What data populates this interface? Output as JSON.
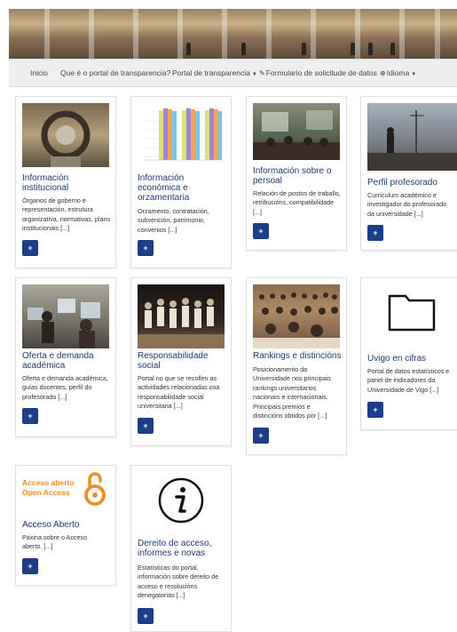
{
  "nav": {
    "home": "Inicio",
    "about": "Que é o portal de transparencia?",
    "portal": "Portal de transparencia",
    "form": "Formulario de solicitude de datos",
    "language": "Idioma"
  },
  "cards": [
    {
      "title": "Información institucional",
      "desc": "Órganos de goberno e representación, estrutura organizativa, normativas, plans institucionais [...]",
      "button": "+"
    },
    {
      "title": "Información económica e orzamentaria",
      "desc": "Orzamento, contratación, subvención, patrimonio, convenios [...]",
      "button": "+"
    },
    {
      "title": "Información sobre o persoal",
      "desc": "Relación de postos de traballo, retribucións, compatibilidade [...]",
      "button": "+"
    },
    {
      "title": "Perfil profesorado",
      "desc": "Currículum académico e investigador do profesorado da universidade [...]",
      "button": "+"
    },
    {
      "title": "Oferta e demanda académica",
      "desc": "Oferta e demanda académica, guías docentes, perfil do profesorado [...]",
      "button": "+"
    },
    {
      "title": "Responsabilidade social",
      "desc": "Portal no que se recollen as actividades relacionadas coa responsabilidade social universitaria [...]",
      "button": "+"
    },
    {
      "title": "Rankings e distincións",
      "desc": "Posicionamento da Universidade nos principais rankings universitarios nacionais e internacionais. Principais premios e distincións obtidos por [...]",
      "button": "+"
    },
    {
      "title": "Uvigo en cifras",
      "desc": "Portal de datos estatísticos e panel de indicadores da Universidade de Vigo [...]",
      "button": "+"
    },
    {
      "title": "Acceso Aberto",
      "desc": "Páxina sobre o Acceso aberto. [...]",
      "button": "+"
    },
    {
      "title": "Dereito de acceso, informes e novas",
      "desc": "Estatísticas do portal, información sobre dereito de acceso e resolucións denegatorias [...]",
      "button": "+"
    }
  ],
  "open_access_logo": {
    "line1": "Acceso aberto",
    "line2": "Open Access",
    "color": "#f28c28"
  },
  "colors": {
    "accent": "#1c3d87",
    "title": "#1d3a7a"
  }
}
